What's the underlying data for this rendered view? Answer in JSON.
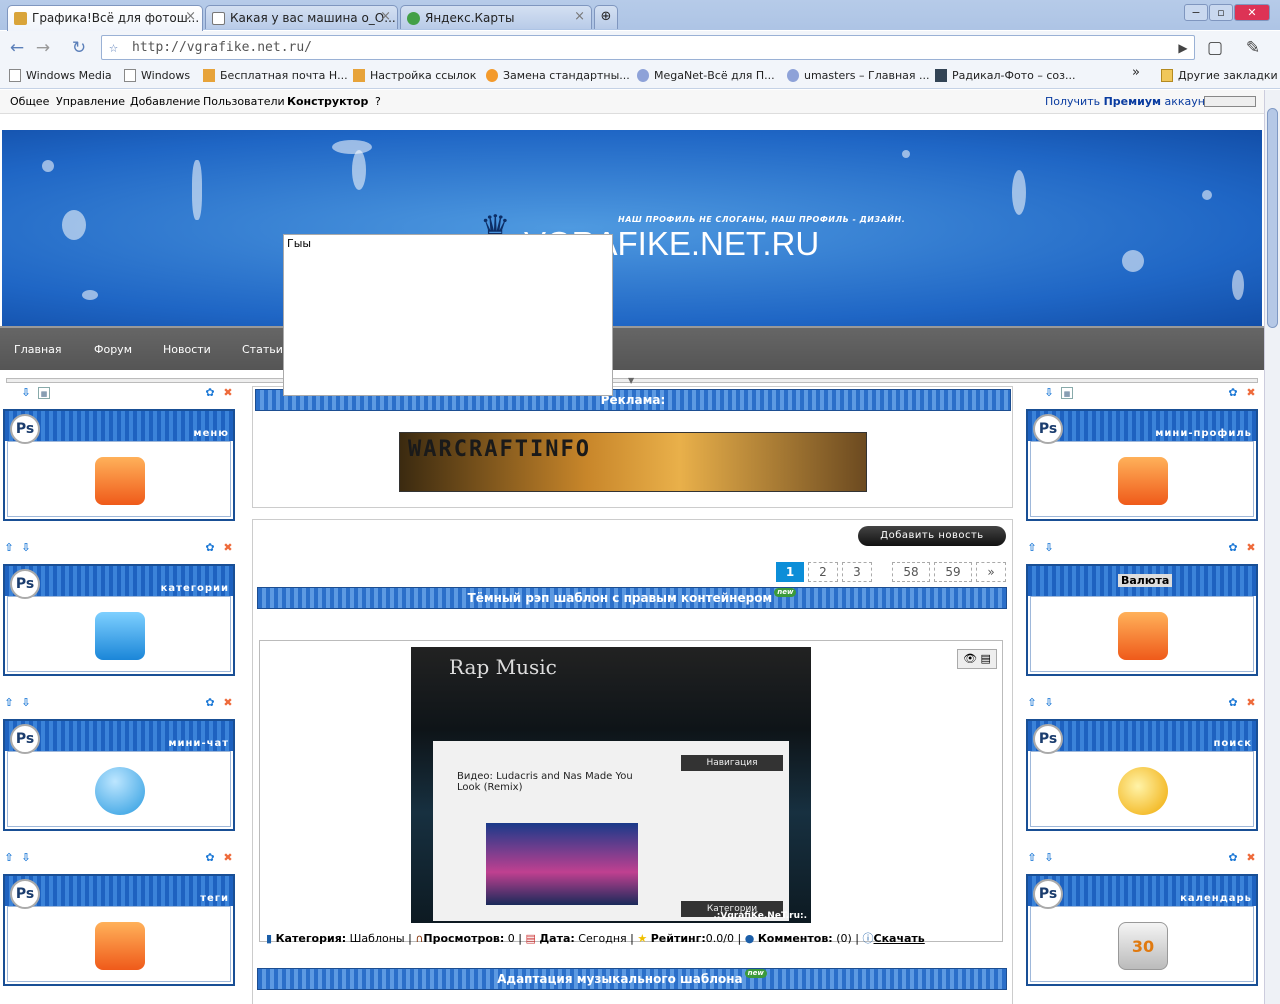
{
  "browser": {
    "tabs": [
      {
        "title": "Графика!Всё для фотош..."
      },
      {
        "title": "Какая у вас машина о_О..."
      },
      {
        "title": "Яндекс.Карты"
      }
    ],
    "url": "http://vgrafike.net.ru/",
    "bookmarks": [
      "Windows Media",
      "Windows",
      "Бесплатная почта Н...",
      "Настройка ссылок",
      "Замена стандартны...",
      "MegaNet-Всё для П...",
      "umasters – Главная ...",
      "Радикал-Фото – соз..."
    ],
    "bookmarks_more": "»",
    "other_bookmarks": "Другие закладки"
  },
  "ucoz_bar": {
    "menu": [
      "Общее",
      "Управление",
      "Добавление",
      "Пользователи",
      "Конструктор",
      "?"
    ],
    "premium_pre": "Получить ",
    "premium_bold": "Премиум",
    "premium_post": " аккаунт"
  },
  "site": {
    "slogan": "НАШ ПРОФИЛЬ НЕ СЛОГАНЫ, НАШ ПРОФИЛЬ - ДИЗАЙН.",
    "logo": "VGRAFIKE.NET.RU",
    "nav": [
      "Главная",
      "Форум",
      "Новости",
      "Статьи"
    ],
    "popup_text": "Гыы",
    "left_blocks": [
      "меню",
      "категории",
      "мини-чат",
      "теги"
    ],
    "right_blocks": [
      "мини-профиль",
      "Валюта",
      "поиск",
      "календарь"
    ],
    "ad_title": "Реклама:",
    "ad_banner": "WARCRAFTINFO",
    "add_news": "Добавить новость",
    "pages": [
      "1",
      "2",
      "3",
      "58",
      "59",
      "»"
    ],
    "news": [
      {
        "title": "Тёмный рэп шаблон с правым контейнером",
        "badge": "new"
      },
      {
        "title": "Адаптация музыкального шаблона",
        "badge": "new"
      }
    ],
    "preview": {
      "site_title": "Rap Music",
      "post_title": "Видео: Ludacris and Nas Made You Look (Remix)",
      "nav_head": "Навигация",
      "cat_head": "Категории",
      "watermark": ".:VgrafiKe.NeT.ru:."
    },
    "meta": {
      "cat_label": "Категория:",
      "cat_value": "Шаблоны",
      "views_label": "Просмотров:",
      "views_value": "0",
      "date_label": "Дата:",
      "date_value": "Сегодня",
      "rating_label": "Рейтинг:",
      "rating_value": "0.0/0",
      "comments_label": "Комментов:",
      "comments_value": "(0)",
      "download": "Скачать"
    }
  }
}
